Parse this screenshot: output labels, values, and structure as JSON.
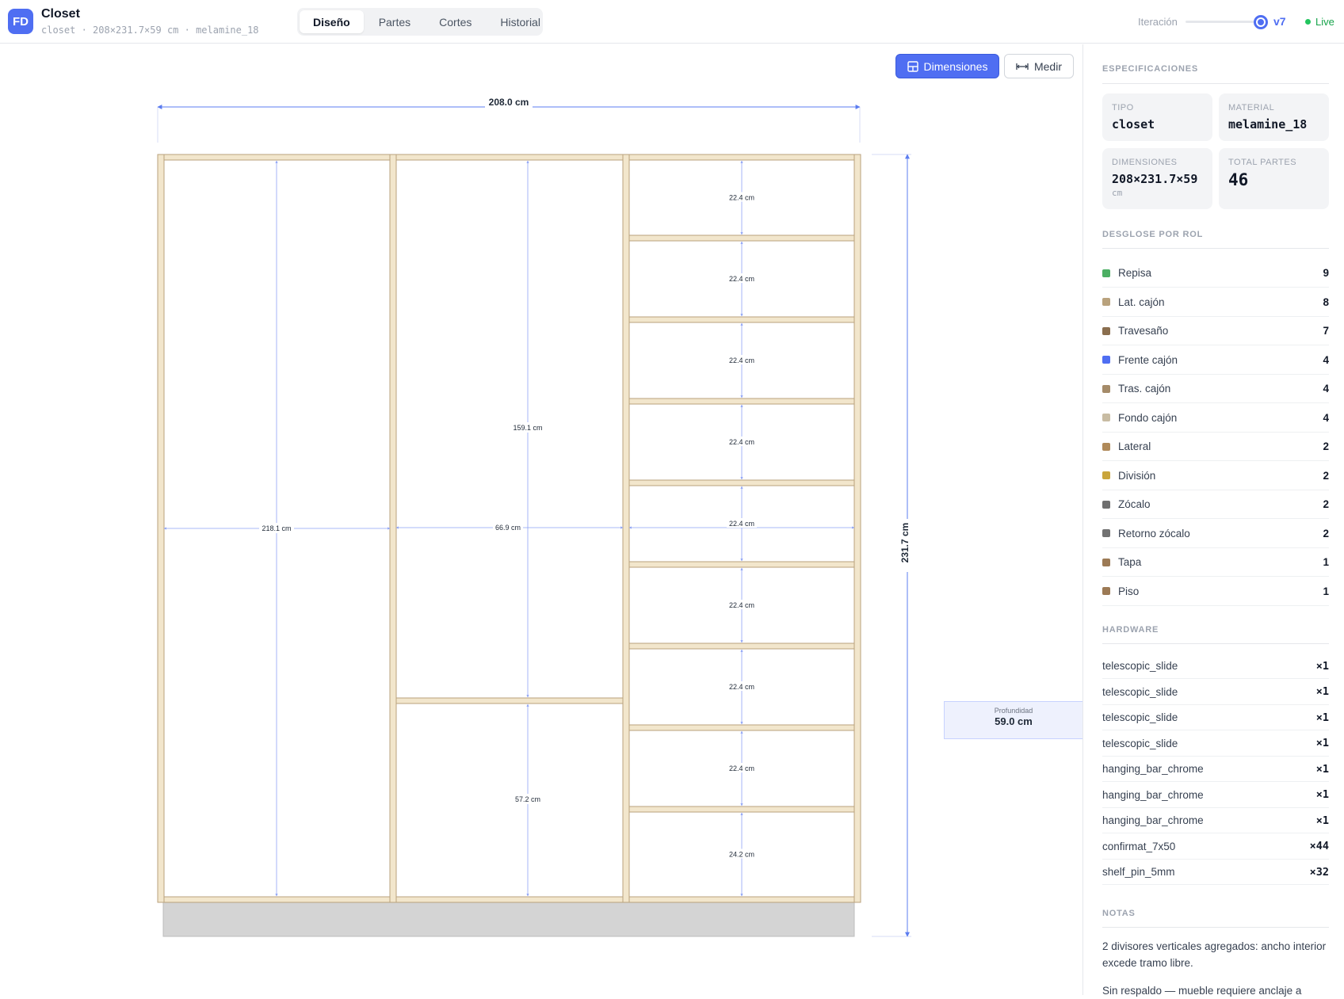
{
  "header": {
    "logo_text": "FD",
    "title": "Closet",
    "subtitle": "closet · 208×231.7×59 cm · melamine_18",
    "tabs": [
      "Diseño",
      "Partes",
      "Cortes",
      "Historial"
    ],
    "active_tab": "Diseño",
    "iteration_label": "Iteración",
    "iteration_value": "v7",
    "live_label": "Live"
  },
  "toolbar": {
    "dimensions_label": "Dimensiones",
    "measure_label": "Medir"
  },
  "drawing": {
    "overall_width": "208.0 cm",
    "overall_height": "231.7 cm",
    "left_bay_height": "218.1 cm",
    "middle_bay_width": "66.9 cm",
    "middle_upper_height": "159.1 cm",
    "middle_lower_height": "57.2 cm",
    "right_shelf_gaps": [
      "22.4 cm",
      "22.4 cm",
      "22.4 cm",
      "22.4 cm",
      "22.4 cm",
      "22.4 cm",
      "22.4 cm",
      "22.4 cm",
      "24.2 cm"
    ],
    "depth_label": "Profundidad",
    "depth_value": "59.0 cm",
    "colors": {
      "board": "#f2e6cc",
      "board_edge": "#b9a27d",
      "dim_line": "#5b7cf0",
      "plinth": "#d4d4d4"
    }
  },
  "sidebar": {
    "specs_title": "ESPECIFICACIONES",
    "specs": {
      "type_label": "TIPO",
      "type_value": "closet",
      "material_label": "MATERIAL",
      "material_value": "melamine_18",
      "dims_label": "DIMENSIONES",
      "dims_value": "208×231.7×59",
      "dims_unit": "cm",
      "parts_label": "TOTAL PARTES",
      "parts_value": "46"
    },
    "roles_title": "DESGLOSE POR ROL",
    "roles": [
      {
        "name": "Repisa",
        "count": "9",
        "color": "#4caf63"
      },
      {
        "name": "Lat. cajón",
        "count": "8",
        "color": "#b9a27d"
      },
      {
        "name": "Travesaño",
        "count": "7",
        "color": "#8a6e4e"
      },
      {
        "name": "Frente cajón",
        "count": "4",
        "color": "#4f6ef2"
      },
      {
        "name": "Tras. cajón",
        "count": "4",
        "color": "#a58b69"
      },
      {
        "name": "Fondo cajón",
        "count": "4",
        "color": "#c8bca3"
      },
      {
        "name": "Lateral",
        "count": "2",
        "color": "#b08a5a"
      },
      {
        "name": "División",
        "count": "2",
        "color": "#c9a53c"
      },
      {
        "name": "Zócalo",
        "count": "2",
        "color": "#6f6f6f"
      },
      {
        "name": "Retorno zócalo",
        "count": "2",
        "color": "#727272"
      },
      {
        "name": "Tapa",
        "count": "1",
        "color": "#9c7a55"
      },
      {
        "name": "Piso",
        "count": "1",
        "color": "#9c7a55"
      }
    ],
    "hardware_title": "HARDWARE",
    "hardware": [
      {
        "name": "telescopic_slide",
        "qty": "×1"
      },
      {
        "name": "telescopic_slide",
        "qty": "×1"
      },
      {
        "name": "telescopic_slide",
        "qty": "×1"
      },
      {
        "name": "telescopic_slide",
        "qty": "×1"
      },
      {
        "name": "hanging_bar_chrome",
        "qty": "×1"
      },
      {
        "name": "hanging_bar_chrome",
        "qty": "×1"
      },
      {
        "name": "hanging_bar_chrome",
        "qty": "×1"
      },
      {
        "name": "confirmat_7x50",
        "qty": "×44"
      },
      {
        "name": "shelf_pin_5mm",
        "qty": "×32"
      }
    ],
    "notes_title": "NOTAS",
    "notes": [
      "2 divisores verticales agregados: ancho interior excede tramo libre.",
      "Sin respaldo — mueble requiere anclaje a"
    ]
  }
}
